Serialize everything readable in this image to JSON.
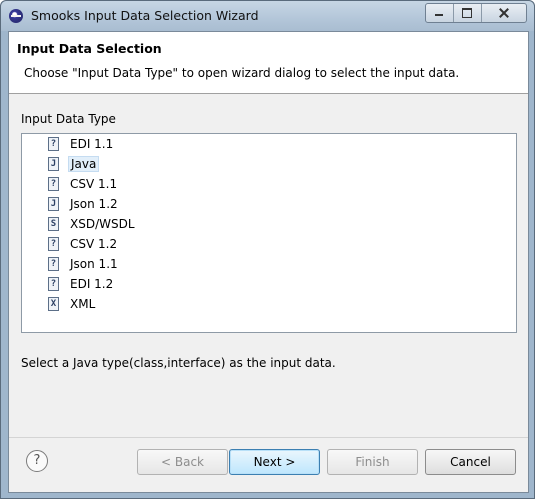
{
  "window": {
    "title": "Smooks Input Data Selection Wizard"
  },
  "header": {
    "title": "Input Data Selection",
    "description": "Choose \"Input Data Type\" to open wizard dialog to select the input data."
  },
  "group": {
    "label": "Input Data Type"
  },
  "types": [
    {
      "label": "EDI 1.1",
      "icon": "question-file-icon",
      "glyph": "?",
      "selected": false
    },
    {
      "label": "Java",
      "icon": "java-file-icon",
      "glyph": "J",
      "selected": true
    },
    {
      "label": "CSV 1.1",
      "icon": "question-file-icon",
      "glyph": "?",
      "selected": false
    },
    {
      "label": "Json 1.2",
      "icon": "java-file-icon",
      "glyph": "J",
      "selected": false
    },
    {
      "label": "XSD/WSDL",
      "icon": "schema-file-icon",
      "glyph": "S",
      "selected": false
    },
    {
      "label": "CSV 1.2",
      "icon": "question-file-icon",
      "glyph": "?",
      "selected": false
    },
    {
      "label": "Json 1.1",
      "icon": "question-file-icon",
      "glyph": "?",
      "selected": false
    },
    {
      "label": "EDI 1.2",
      "icon": "question-file-icon",
      "glyph": "?",
      "selected": false
    },
    {
      "label": "XML",
      "icon": "xml-file-icon",
      "glyph": "X",
      "selected": false
    }
  ],
  "hint": "Select a Java type(class,interface) as the input data.",
  "buttons": {
    "back": "< Back",
    "next": "Next >",
    "finish": "Finish",
    "cancel": "Cancel"
  },
  "help": {
    "glyph": "?"
  },
  "colors": {
    "selection": "#e2effa",
    "default_button": "#bee6fd",
    "titlebar": "#b3c6d9"
  }
}
